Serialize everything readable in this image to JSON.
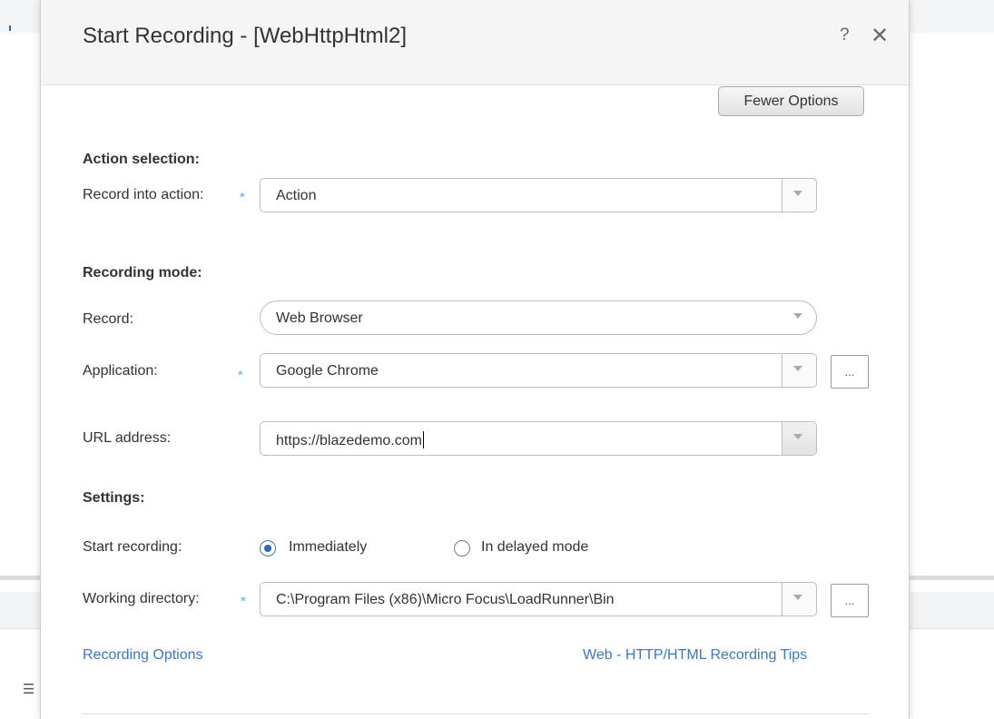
{
  "dialog": {
    "title": "Start Recording - [WebHttpHtml2]",
    "help_icon": "?",
    "close_icon": "✕"
  },
  "toolbar": {
    "fewer_options_label": "Fewer Options"
  },
  "action_selection": {
    "heading": "Action selection:",
    "record_into_label": "Record into action:",
    "record_into_value": "Action"
  },
  "recording_mode": {
    "heading": "Recording mode:",
    "record_label": "Record:",
    "record_value": "Web Browser",
    "application_label": "Application:",
    "application_value": "Google Chrome",
    "url_label": "URL address:",
    "url_value": "https://blazedemo.com"
  },
  "settings": {
    "heading": "Settings:",
    "start_recording_label": "Start recording:",
    "option_immediately": "Immediately",
    "option_delayed": "In delayed mode",
    "selected_option": "Immediately",
    "working_dir_label": "Working directory:",
    "working_dir_value": "C:\\Program Files (x86)\\Micro Focus\\LoadRunner\\Bin"
  },
  "links": {
    "recording_options": "Recording Options",
    "recording_tips": "Web - HTTP/HTML Recording Tips"
  },
  "common": {
    "required_mark": "*",
    "browse_label": "..."
  },
  "colors": {
    "accent": "#3b78c3",
    "required": "#6aa9dc",
    "radio": "#2a6db8"
  },
  "icons": {
    "bg_list_icon": "☰"
  }
}
